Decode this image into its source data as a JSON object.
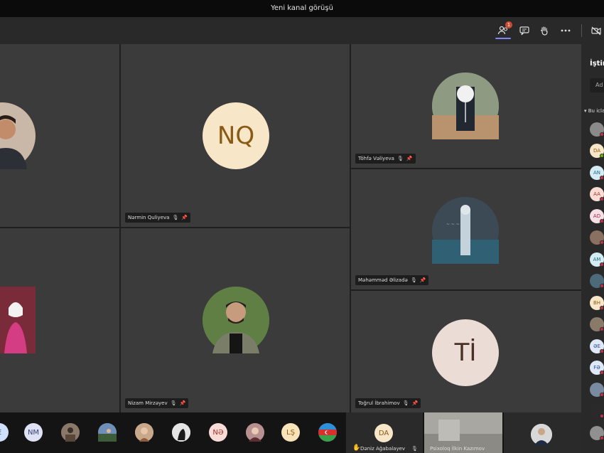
{
  "window": {
    "title": "Yeni kanal görüşü"
  },
  "toolbar": {
    "participants_badge": "1",
    "icons": [
      "participants-icon",
      "chat-icon",
      "raise-hand-icon",
      "more-icon",
      "video-off-icon"
    ]
  },
  "tiles": [
    {
      "name": "",
      "initials": ""
    },
    {
      "name": "Nərmin Quliyeva",
      "initials": "NQ",
      "bg": "#f7e6c7",
      "fg": "#8a5a15"
    },
    {
      "name": "Töhfə Vəliyeva",
      "initials": ""
    },
    {
      "name": "Məhəmməd Əlizadə",
      "initials": ""
    },
    {
      "name": "",
      "initials": ""
    },
    {
      "name": "Nizam Mirzəyev",
      "initials": ""
    },
    {
      "name": "Toğrul İbrahimov",
      "initials": "Tİ",
      "bg": "#ecdcd6",
      "fg": "#4a2f25"
    }
  ],
  "strip": {
    "initials": [
      "E",
      "NM",
      "NƏ",
      "LŞ",
      "DA"
    ],
    "speaker1": "Dəniz Ağabalayev",
    "speaker2": "Psixoloq İlkin Kazımov"
  },
  "panel": {
    "title": "İştir",
    "search_placeholder": "Ad",
    "section": "Bu icla",
    "initials": [
      "DA",
      "AN",
      "AA",
      "AD",
      "AM",
      "BH",
      "ƏE",
      "FƏ"
    ]
  },
  "colors": {
    "accent": "#7f85f5",
    "badge": "#cc4a31",
    "status_busy": "#c4314b"
  }
}
